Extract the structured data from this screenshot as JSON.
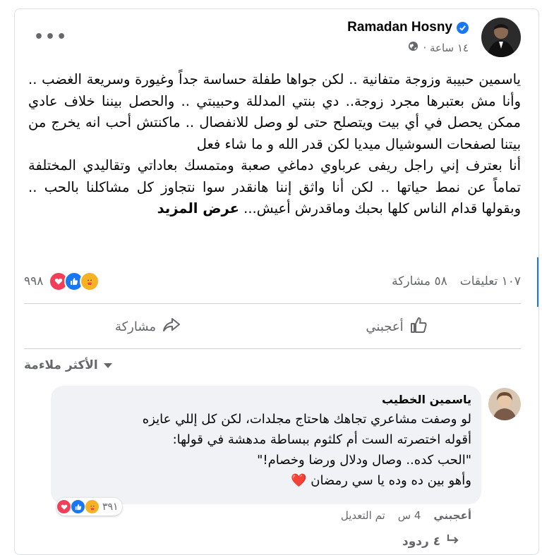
{
  "post": {
    "author": "Ramadan Hosny",
    "time": "١٤ ساعة ·",
    "more_label": "•••",
    "text_p1": "ياسمين حبيبة وزوجة متفانية .. لكن جواها طفلة حساسة جداً وغيورة وسريعة الغضب .. وأنا مش بعتبرها مجرد زوجة.. دي بنتي المدللة وحبيبتي .. والحصل بيننا خلاف عادي ممكن يحصل في أي بيت ويتصلح حتى لو وصل للانفصال .. ماكنتش أحب انه يخرج من بيتنا لصفحات السوشيال ميديا لكن قدر الله و ما شاء فعل",
    "text_p2": "أنا بعترف إني راجل ريفى عرباوي دماغي صعبة ومتمسك بعاداتي وتقاليدي المختلفة تماماً عن نمط حياتها .. لكن أنا واثق إننا هانقدر سوا نتجاوز كل مشاكلنا بالحب .. وبقولها قدام الناس كلها بحبك وماقدرش أعيش...",
    "see_more": "عرض المزيد",
    "reactions_count": "٩٩٨",
    "comments_count": "١٠٧ تعليقات",
    "shares_count": "٥٨ مشاركة"
  },
  "actions": {
    "like": "أعجبني",
    "share": "مشاركة"
  },
  "comments_sort": "الأكثر ملاءمة",
  "comment": {
    "author": "ياسمين الخطيب",
    "line1": "لو وصفت مشاعري تجاهك هاحتاج مجلدات، لكن كل إللي عايزه",
    "line2": "أقوله اختصرته الست أم كلثوم ببساطة مدهشة في قولها:",
    "line3": "\"الحب كده.. وصال ودلال ورضا وخصام!\"",
    "line4": "وأهو بين ده وده يا سي رمضان",
    "heart": "❤️",
    "reactions_count": "٣٩١",
    "like": "أعجبني",
    "time": "4 س",
    "edited": "تم التعديل",
    "replies": "٤ ردود"
  },
  "colors": {
    "brand_blue": "#1877f2",
    "love_red": "#f33e58",
    "care_yellow": "#f7b125"
  }
}
